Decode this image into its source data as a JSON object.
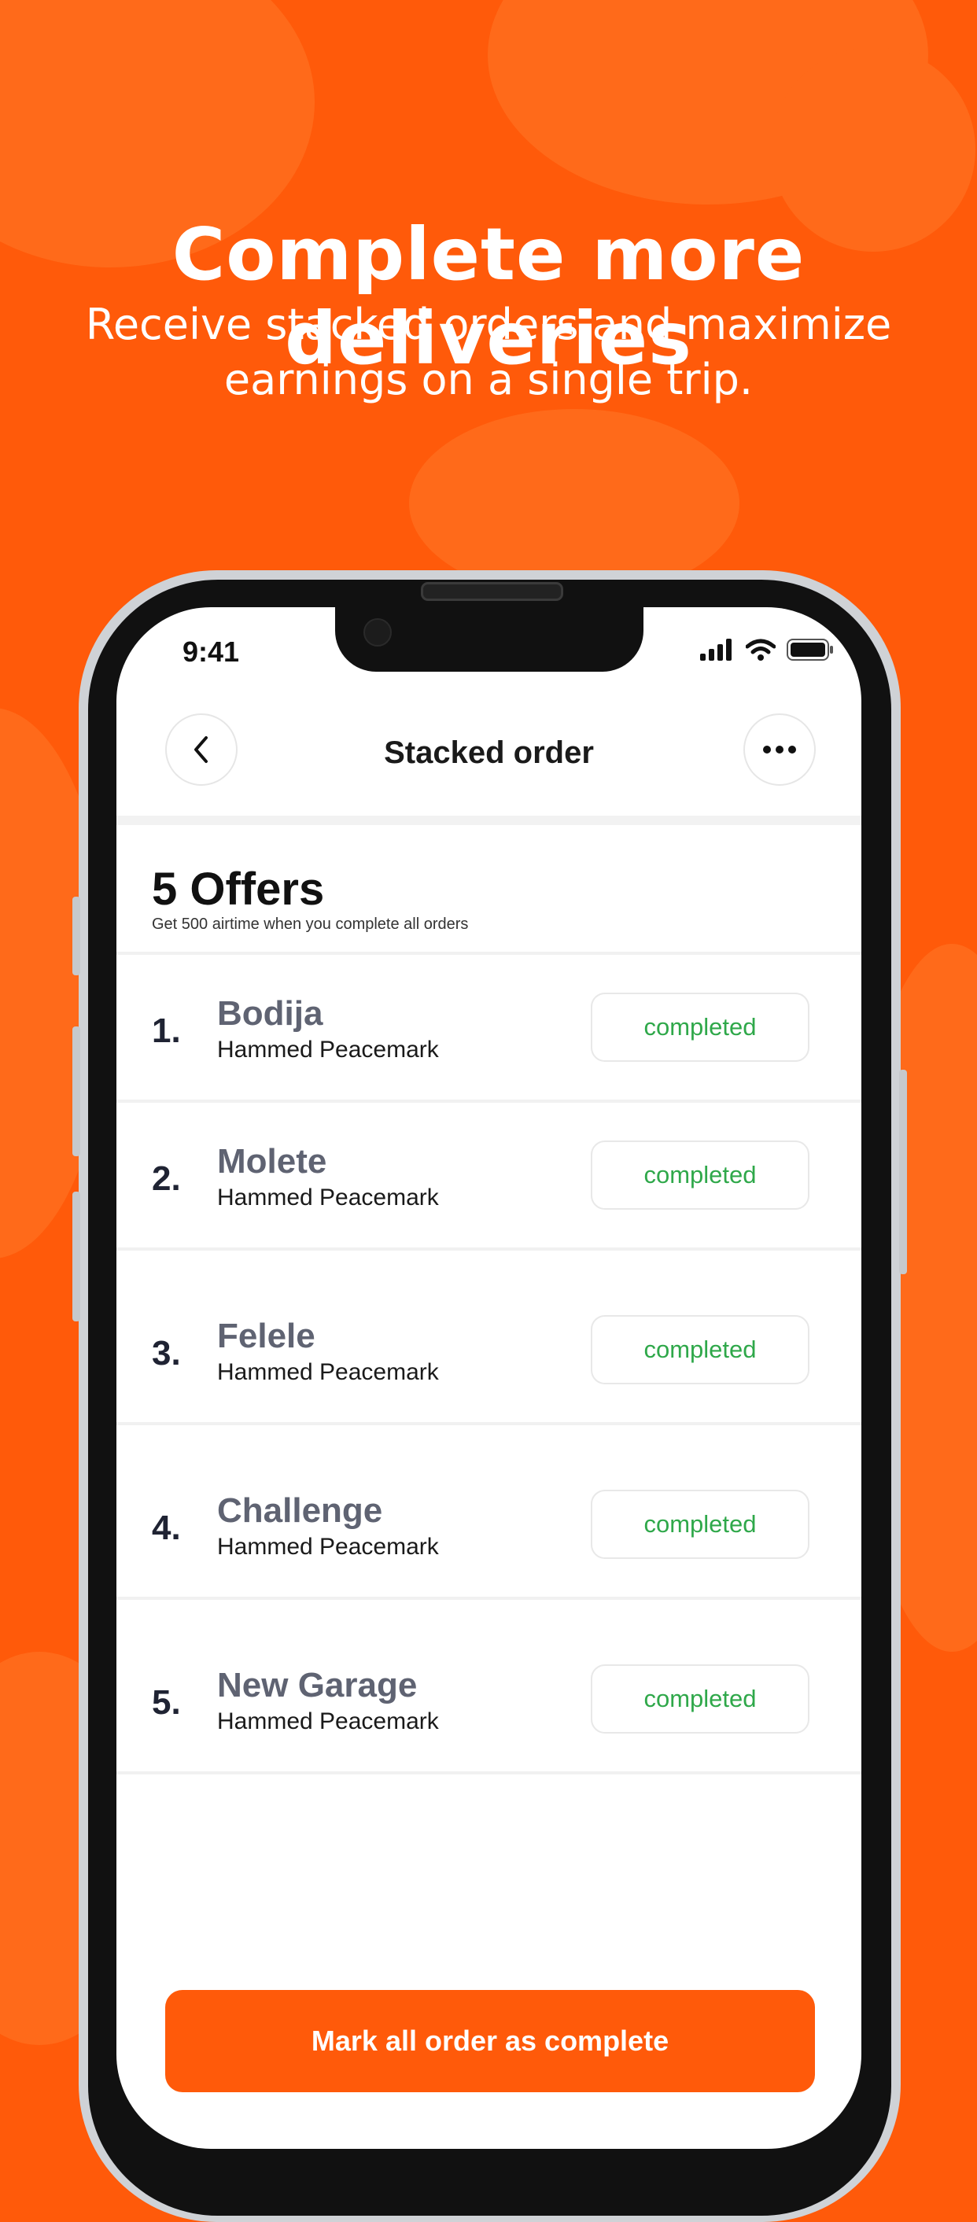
{
  "promo": {
    "headline": "Complete more deliveries",
    "subheadline_line1": "Receive stacked orders and maximize",
    "subheadline_line2": "earnings on a single trip."
  },
  "status_bar": {
    "time": "9:41"
  },
  "header": {
    "title": "Stacked order",
    "back_icon": "chevron-left-icon",
    "more_icon": "more-horizontal-icon"
  },
  "offers": {
    "title": "5 Offers",
    "subtitle": "Get 500 airtime when you complete all orders"
  },
  "orders": [
    {
      "number": "1.",
      "location": "Bodija",
      "name": "Hammed Peacemark",
      "status": "completed"
    },
    {
      "number": "2.",
      "location": "Molete",
      "name": "Hammed Peacemark",
      "status": "completed"
    },
    {
      "number": "3.",
      "location": "Felele",
      "name": "Hammed Peacemark",
      "status": "completed"
    },
    {
      "number": "4.",
      "location": "Challenge",
      "name": "Hammed Peacemark",
      "status": "completed"
    },
    {
      "number": "5.",
      "location": "New Garage",
      "name": "Hammed Peacemark",
      "status": "completed"
    }
  ],
  "cta": {
    "label": "Mark all order as complete"
  },
  "colors": {
    "brand": "#ff5a0a",
    "completed": "#2fa84a"
  }
}
